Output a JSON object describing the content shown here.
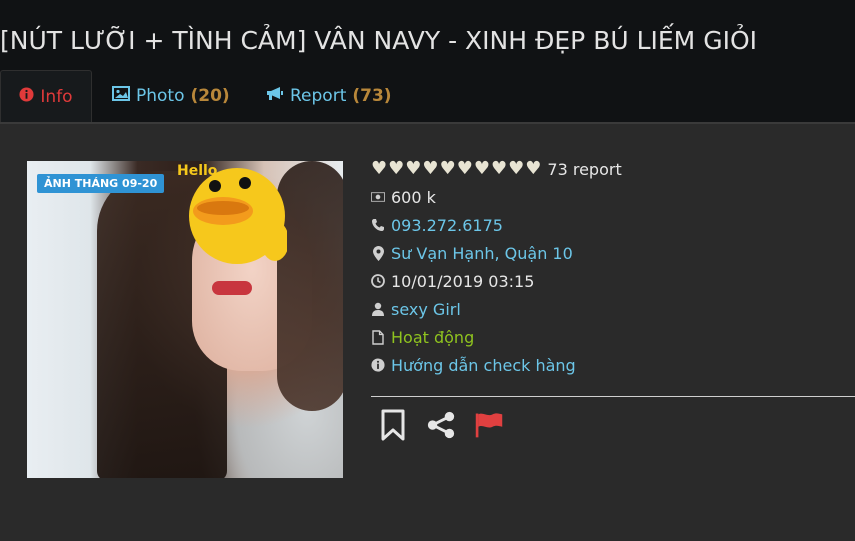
{
  "title": "[NÚT LƯỠI + TÌNH CẢM] VÂN NAVY - XINH ĐẸP BÚ LIẾM GIỎI",
  "tabs": {
    "info": {
      "label": "Info"
    },
    "photo": {
      "label": "Photo",
      "count": "(20)"
    },
    "report": {
      "label": "Report",
      "count": "(73)"
    }
  },
  "photo": {
    "badge": "ẢNH THÁNG 09-20"
  },
  "details": {
    "rating_hearts": 10,
    "report_text": "73 report",
    "price": "600 k",
    "phone": "093.272.6175",
    "location": "Sư Vạn Hạnh, Quận 10",
    "datetime": "10/01/2019 03:15",
    "category": "sexy Girl",
    "status": "Hoạt động",
    "guide": "Hướng dẫn check hàng"
  },
  "colors": {
    "accent_link": "#6cc6e8",
    "active_tab": "#e03a3a",
    "status_green": "#8fc31f",
    "flag_red": "#e04040",
    "count_brown": "#b8873a"
  },
  "icons": {
    "tab_info": "info-circle-icon",
    "tab_photo": "image-icon",
    "tab_report": "bullhorn-icon",
    "price": "money-icon",
    "phone": "phone-icon",
    "location": "map-marker-icon",
    "datetime": "clock-icon",
    "category": "user-icon",
    "status": "file-icon",
    "guide": "info-circle-icon",
    "bookmark": "bookmark-icon",
    "share": "share-icon",
    "flag": "flag-icon"
  }
}
